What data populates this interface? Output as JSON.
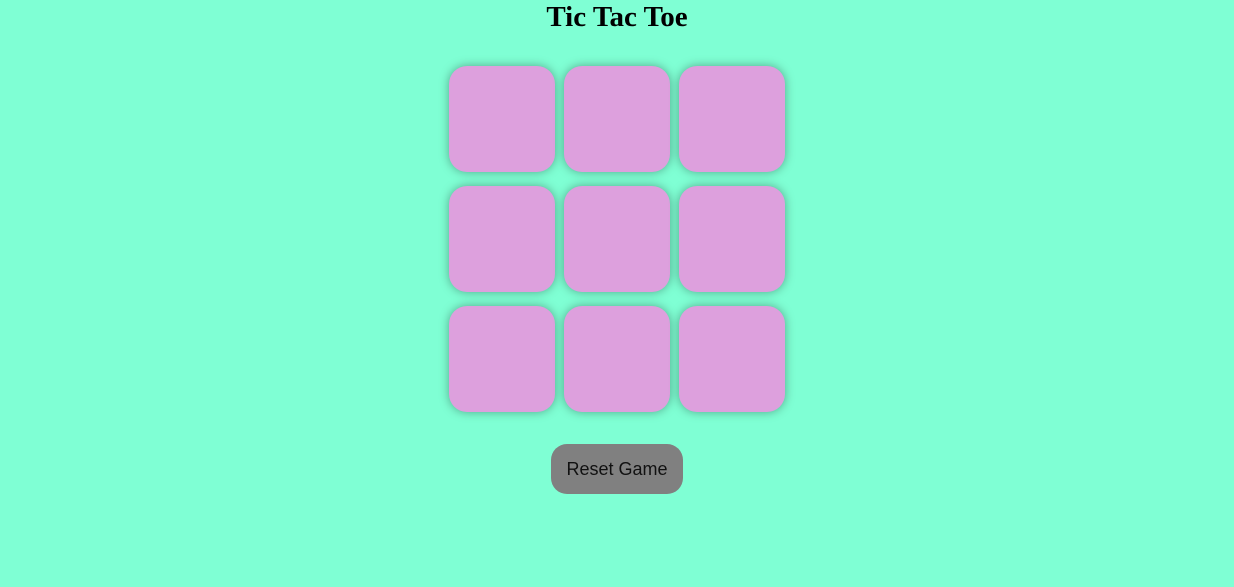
{
  "page": {
    "title": "Tic Tac Toe"
  },
  "colors": {
    "background": "#7fffd4",
    "cell": "#dda0dd",
    "reset_button": "#808080"
  },
  "board": {
    "cells": [
      "",
      "",
      "",
      "",
      "",
      "",
      "",
      "",
      ""
    ]
  },
  "controls": {
    "reset_label": "Reset Game"
  }
}
